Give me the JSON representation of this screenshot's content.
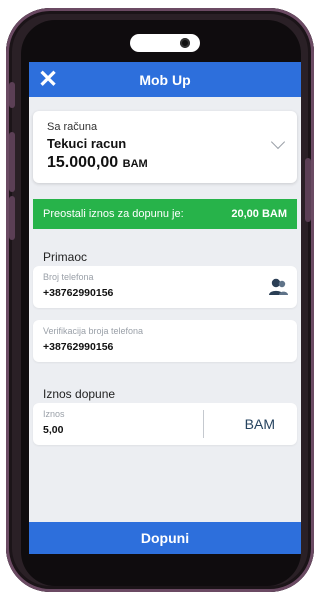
{
  "header": {
    "title": "Mob Up",
    "close_icon": "close-icon"
  },
  "account": {
    "label": "Sa računa",
    "name": "Tekuci racun",
    "amount": "15.000,00",
    "currency": "BAM",
    "dropdown_icon": "chevron-down-icon"
  },
  "remaining": {
    "label": "Preostali iznos za dopunu je:",
    "value": "20,00 BAM"
  },
  "recipient": {
    "section_label": "Primaoc",
    "phone_label": "Broj telefona",
    "phone_value": "+38762990156",
    "contacts_icon": "contact-picker-icon",
    "verify_label": "Verifikacija broja telefona",
    "verify_value": "+38762990156"
  },
  "amount": {
    "section_label": "Iznos dopune",
    "label": "Iznos",
    "value": "5,00",
    "currency": "BAM"
  },
  "submit": {
    "label": "Dopuni"
  },
  "colors": {
    "primary": "#2d6fdc",
    "success": "#27b34a",
    "background": "#eceef2",
    "frame": "#2a2026"
  }
}
